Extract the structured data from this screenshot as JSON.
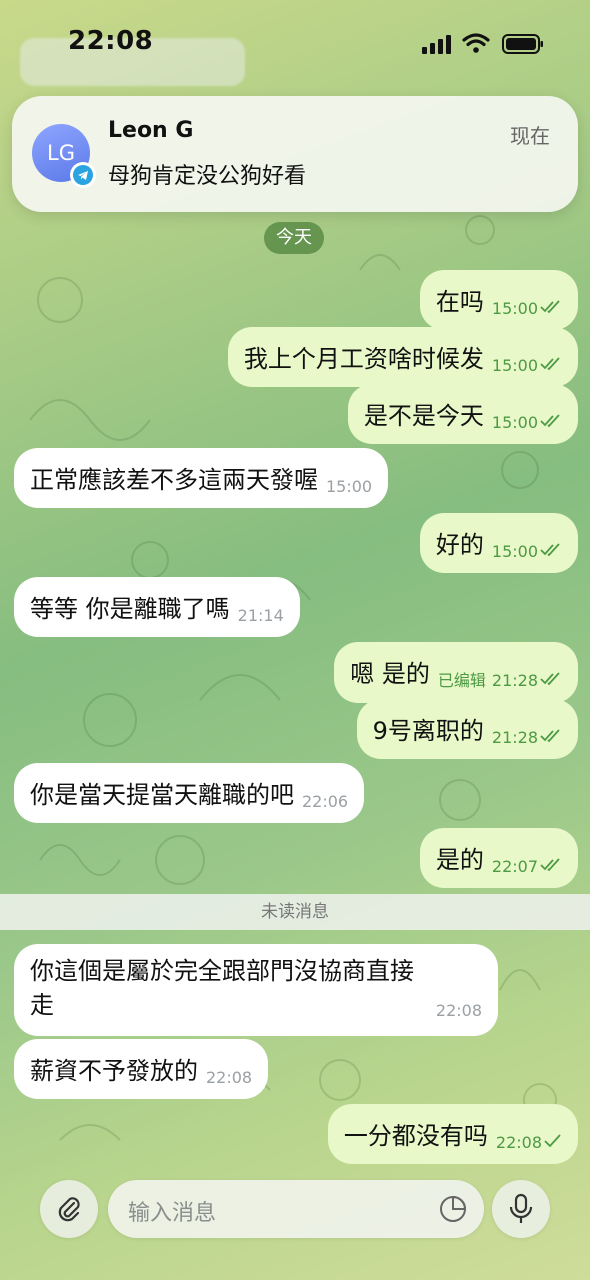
{
  "status_bar": {
    "time": "22:08"
  },
  "notification": {
    "avatar_initials": "LG",
    "sender": "Leon G",
    "message": "母狗肯定没公狗好看",
    "time": "现在"
  },
  "date_chip": "今天",
  "messages": [
    {
      "dir": "out",
      "text": "在吗",
      "time": "15:00",
      "edited": ""
    },
    {
      "dir": "out",
      "text": "我上个月工资啥时候发",
      "time": "15:00",
      "edited": ""
    },
    {
      "dir": "out",
      "text": "是不是今天",
      "time": "15:00",
      "edited": ""
    },
    {
      "dir": "in",
      "text": "正常應該差不多這兩天發喔",
      "time": "15:00",
      "edited": ""
    },
    {
      "dir": "out",
      "text": "好的",
      "time": "15:00",
      "edited": ""
    },
    {
      "dir": "in",
      "text": "等等 你是離職了嗎",
      "time": "21:14",
      "edited": ""
    },
    {
      "dir": "out",
      "text": "嗯 是的",
      "time": "21:28",
      "edited": "已编辑"
    },
    {
      "dir": "out",
      "text": "9号离职的",
      "time": "21:28",
      "edited": ""
    },
    {
      "dir": "in",
      "text": "你是當天提當天離職的吧",
      "time": "22:06",
      "edited": ""
    },
    {
      "dir": "out",
      "text": "是的",
      "time": "22:07",
      "edited": ""
    },
    {
      "dir": "in",
      "text": "你這個是屬於完全跟部門沒協商直接",
      "text2": "走",
      "time": "22:08",
      "edited": ""
    },
    {
      "dir": "in",
      "text": "薪資不予發放的",
      "time": "22:08",
      "edited": ""
    },
    {
      "dir": "out",
      "text": "一分都没有吗",
      "time": "22:08",
      "edited": ""
    }
  ],
  "unread_label": "未读消息",
  "composer": {
    "placeholder": "输入消息"
  }
}
